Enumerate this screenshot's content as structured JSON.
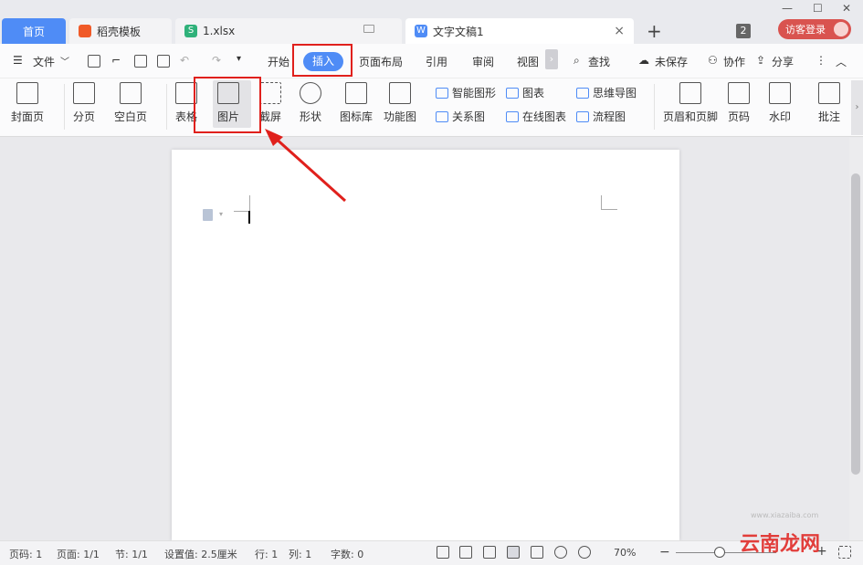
{
  "tabs": {
    "home": "首页",
    "daoke": "稻壳模板",
    "xlsx": "1.xlsx",
    "doc": "文字文稿1",
    "close": "×",
    "add": "+",
    "badge": "2",
    "login": "访客登录"
  },
  "window": {
    "minimize": "—",
    "maximize": "☐",
    "close": "✕"
  },
  "menu": {
    "file": "文件",
    "start": "开始",
    "insert": "插入",
    "layout": "页面布局",
    "references": "引用",
    "review": "审阅",
    "view": "视图",
    "search": "查找",
    "unsaved": "未保存",
    "collab": "协作",
    "share": "分享",
    "more_arrow": "›"
  },
  "ribbon": {
    "cover": "封面页",
    "pagebreak": "分页",
    "blank": "空白页",
    "table": "表格",
    "picture": "图片",
    "screenshot": "截屏",
    "shape": "形状",
    "iconlib": "图标库",
    "funcchart": "功能图",
    "smartart": "智能图形",
    "chart": "图表",
    "mindmap": "思维导图",
    "relation": "关系图",
    "onlinechart": "在线图表",
    "flowchart": "流程图",
    "headerfooter": "页眉和页脚",
    "pagenum": "页码",
    "watermark": "水印",
    "comment": "批注"
  },
  "status": {
    "pagecode": "页码: 1",
    "pages": "页面: 1/1",
    "section": "节: 1/1",
    "setting": "设置值: 2.5厘米",
    "row": "行: 1",
    "col": "列: 1",
    "words": "字数: 0",
    "zoom": "70%",
    "zoom_out": "−",
    "zoom_in": "+"
  },
  "brand": {
    "watermark": "云南龙网",
    "url": "www.xiazaiba.com"
  },
  "colors": {
    "accent": "#4f8cf6",
    "highlight": "#e0201c",
    "login": "#d9534f"
  }
}
